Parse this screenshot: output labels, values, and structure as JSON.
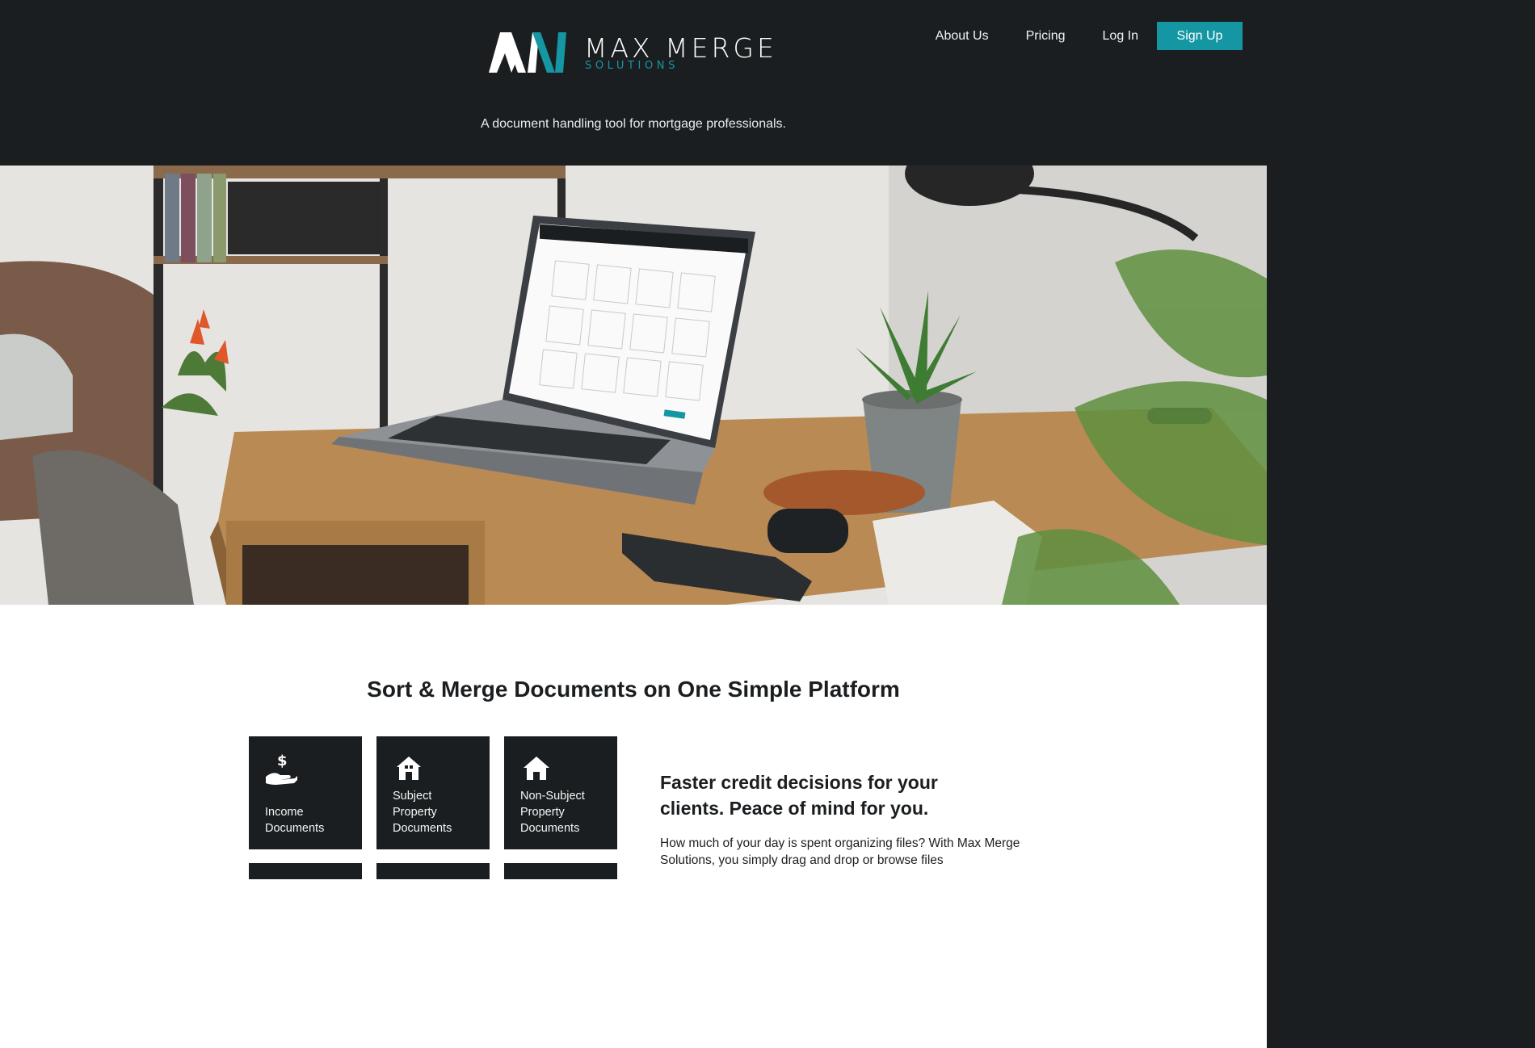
{
  "brand": {
    "name": "MAX MERGE",
    "subtitle": "SOLUTIONS",
    "tagline": "A document handling tool for mortgage professionals."
  },
  "nav": {
    "items": [
      "About Us",
      "Pricing",
      "Log In"
    ],
    "signup": "Sign Up"
  },
  "colors": {
    "accent": "#1597a3",
    "dark": "#1b1e20"
  },
  "hero": {
    "icon": "laptop-desk-photo"
  },
  "section": {
    "title": "Sort & Merge Documents on One Simple Platform",
    "tiles": [
      {
        "label": "Income Documents",
        "icon": "hand-dollar-icon"
      },
      {
        "label": "Subject Property Documents",
        "icon": "house-icon"
      },
      {
        "label": "Non-Subject Property Documents",
        "icon": "house-icon"
      }
    ],
    "feature_title": "Faster credit decisions for your clients. Peace of mind for you.",
    "feature_body": "How much of your day is spent organizing files? With Max Merge Solutions, you simply drag and drop or browse files"
  }
}
